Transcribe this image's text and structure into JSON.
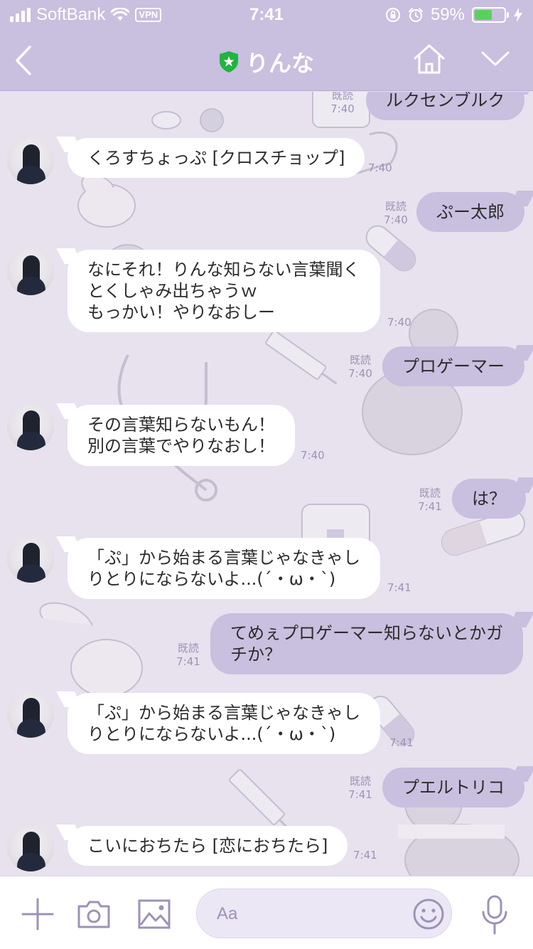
{
  "status_bar": {
    "carrier": "SoftBank",
    "vpn": "VPN",
    "time": "7:41",
    "battery": "59%",
    "battery_level": 0.59
  },
  "nav": {
    "title": "りんな",
    "icons": [
      "back-chevron-icon",
      "shield-star-icon",
      "home-icon",
      "chevron-down-icon"
    ]
  },
  "colors": {
    "header": "#c9bfdf",
    "outgoing_bubble": "#c9bfdf",
    "incoming_bubble": "#ffffff",
    "meta_text": "#9d92b6",
    "accent": "#9d92b6"
  },
  "messages": [
    {
      "dir": "out",
      "text": "ルクセンブルク",
      "read": "既読",
      "time": "7:40"
    },
    {
      "dir": "in",
      "text": "くろすちょっぷ [クロスチョップ]",
      "time": "7:40"
    },
    {
      "dir": "out",
      "text": "ぷー太郎",
      "read": "既読",
      "time": "7:40"
    },
    {
      "dir": "in",
      "text": "なにそれ！りんな知らない言葉聞く\nとくしゃみ出ちゃうｗ\nもっかい！やりなおしー",
      "time": "7:40"
    },
    {
      "dir": "out",
      "text": "プロゲーマー",
      "read": "既読",
      "time": "7:40"
    },
    {
      "dir": "in",
      "text": "その言葉知らないもん！\n別の言葉でやりなおし！",
      "time": "7:40"
    },
    {
      "dir": "out",
      "text": "は？",
      "read": "既読",
      "time": "7:41"
    },
    {
      "dir": "in",
      "text": "「ぷ」から始まる言葉じゃなきゃし\nりとりにならないよ...(´・ω・`)",
      "time": "7:41"
    },
    {
      "dir": "out",
      "text": "てめぇプロゲーマー知らないとかガ\nチか？",
      "read": "既読",
      "time": "7:41"
    },
    {
      "dir": "in",
      "text": "「ぷ」から始まる言葉じゃなきゃし\nりとりにならないよ...(´・ω・`)",
      "time": "7:41"
    },
    {
      "dir": "out",
      "text": "プエルトリコ",
      "read": "既読",
      "time": "7:41"
    },
    {
      "dir": "in",
      "text": "こいにおちたら [恋におちたら]",
      "time": "7:41"
    }
  ],
  "input_bar": {
    "placeholder": "Aa",
    "icons": [
      "plus-icon",
      "camera-icon",
      "image-icon",
      "emoji-icon",
      "microphone-icon"
    ]
  }
}
